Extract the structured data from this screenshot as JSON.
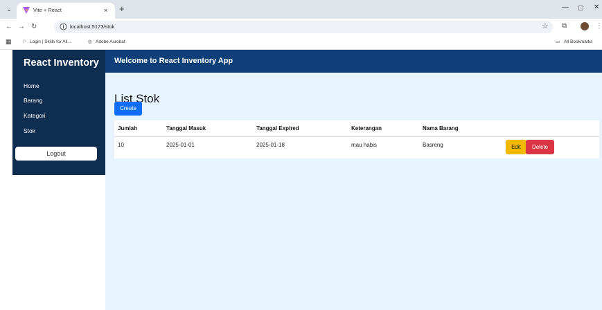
{
  "browser": {
    "tab_title": "Vite + React",
    "tab_close": "×",
    "new_tab": "+",
    "url": "localhost:5173/stok",
    "bookmarks": [
      "Login | Skills for All...",
      "Adobe Acrobat"
    ],
    "all_bookmarks": "All Bookmarks",
    "win_min": "—",
    "win_max": "▢",
    "win_close": "✕"
  },
  "sidebar": {
    "brand": "React Inventory",
    "items": [
      {
        "label": "Home"
      },
      {
        "label": "Barang"
      },
      {
        "label": "Kategori"
      },
      {
        "label": "Stok"
      }
    ],
    "logout_label": "Logout"
  },
  "header": {
    "title": "Welcome to React Inventory App"
  },
  "main": {
    "page_title": "List Stok",
    "create_label": "Create",
    "columns": [
      "Jumlah",
      "Tanggal Masuk",
      "Tanggal Expired",
      "Keterangan",
      "Nama Barang"
    ],
    "rows": [
      {
        "jumlah": "10",
        "tanggal_masuk": "2025-01-01",
        "tanggal_expired": "2025-01-18",
        "keterangan": "mau habis",
        "nama_barang": "Basreng"
      }
    ],
    "edit_label": "Edit",
    "delete_label": "Delete"
  },
  "colors": {
    "sidebar_bg": "#0e2d4f",
    "header_bg": "#0e3f78",
    "main_bg": "#e8f4fd",
    "create_btn": "#0d6efd",
    "edit_btn": "#f5b800",
    "delete_btn": "#dc3545"
  }
}
